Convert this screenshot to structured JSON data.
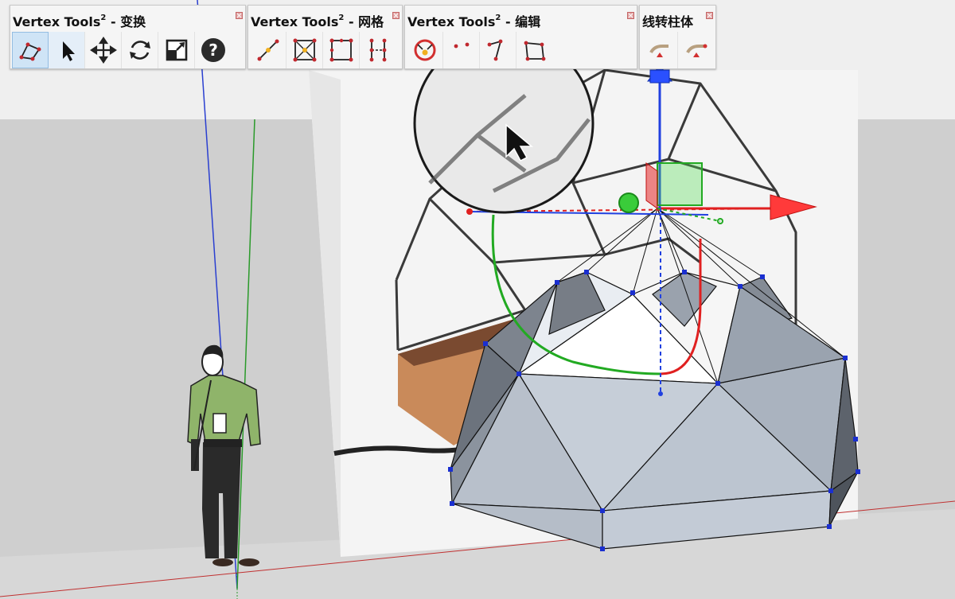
{
  "toolbars": [
    {
      "title": "Vertex Tools",
      "sup": "2",
      "suffix": " - 变换"
    },
    {
      "title": "Vertex Tools",
      "sup": "2",
      "suffix": " - 网格"
    },
    {
      "title": "Vertex Tools",
      "sup": "2",
      "suffix": " - 编辑"
    },
    {
      "title": "线转柱体",
      "sup": "",
      "suffix": ""
    }
  ],
  "colors": {
    "axis_red": "#e02020",
    "axis_green": "#20b020",
    "axis_blue": "#2040e0",
    "vertex_blue": "#1a2fd0",
    "dome_face": "#c3cbd6",
    "active_tool": "#cfe4f6"
  },
  "icons": {
    "transform": [
      "select-region-icon",
      "arrow-select-icon",
      "move-icon",
      "rotate-icon",
      "scale-icon",
      "help-icon"
    ],
    "mesh": [
      "edge-vertex-icon",
      "quad-center-icon",
      "quad-subdivide-icon",
      "grid-split-icon"
    ],
    "edit": [
      "merge-vertices-icon",
      "edit-vertex-icon",
      "edit-edge-icon",
      "edit-face-icon"
    ],
    "lines_to_tubes": [
      "tube-icon",
      "tube-cap-icon"
    ]
  }
}
